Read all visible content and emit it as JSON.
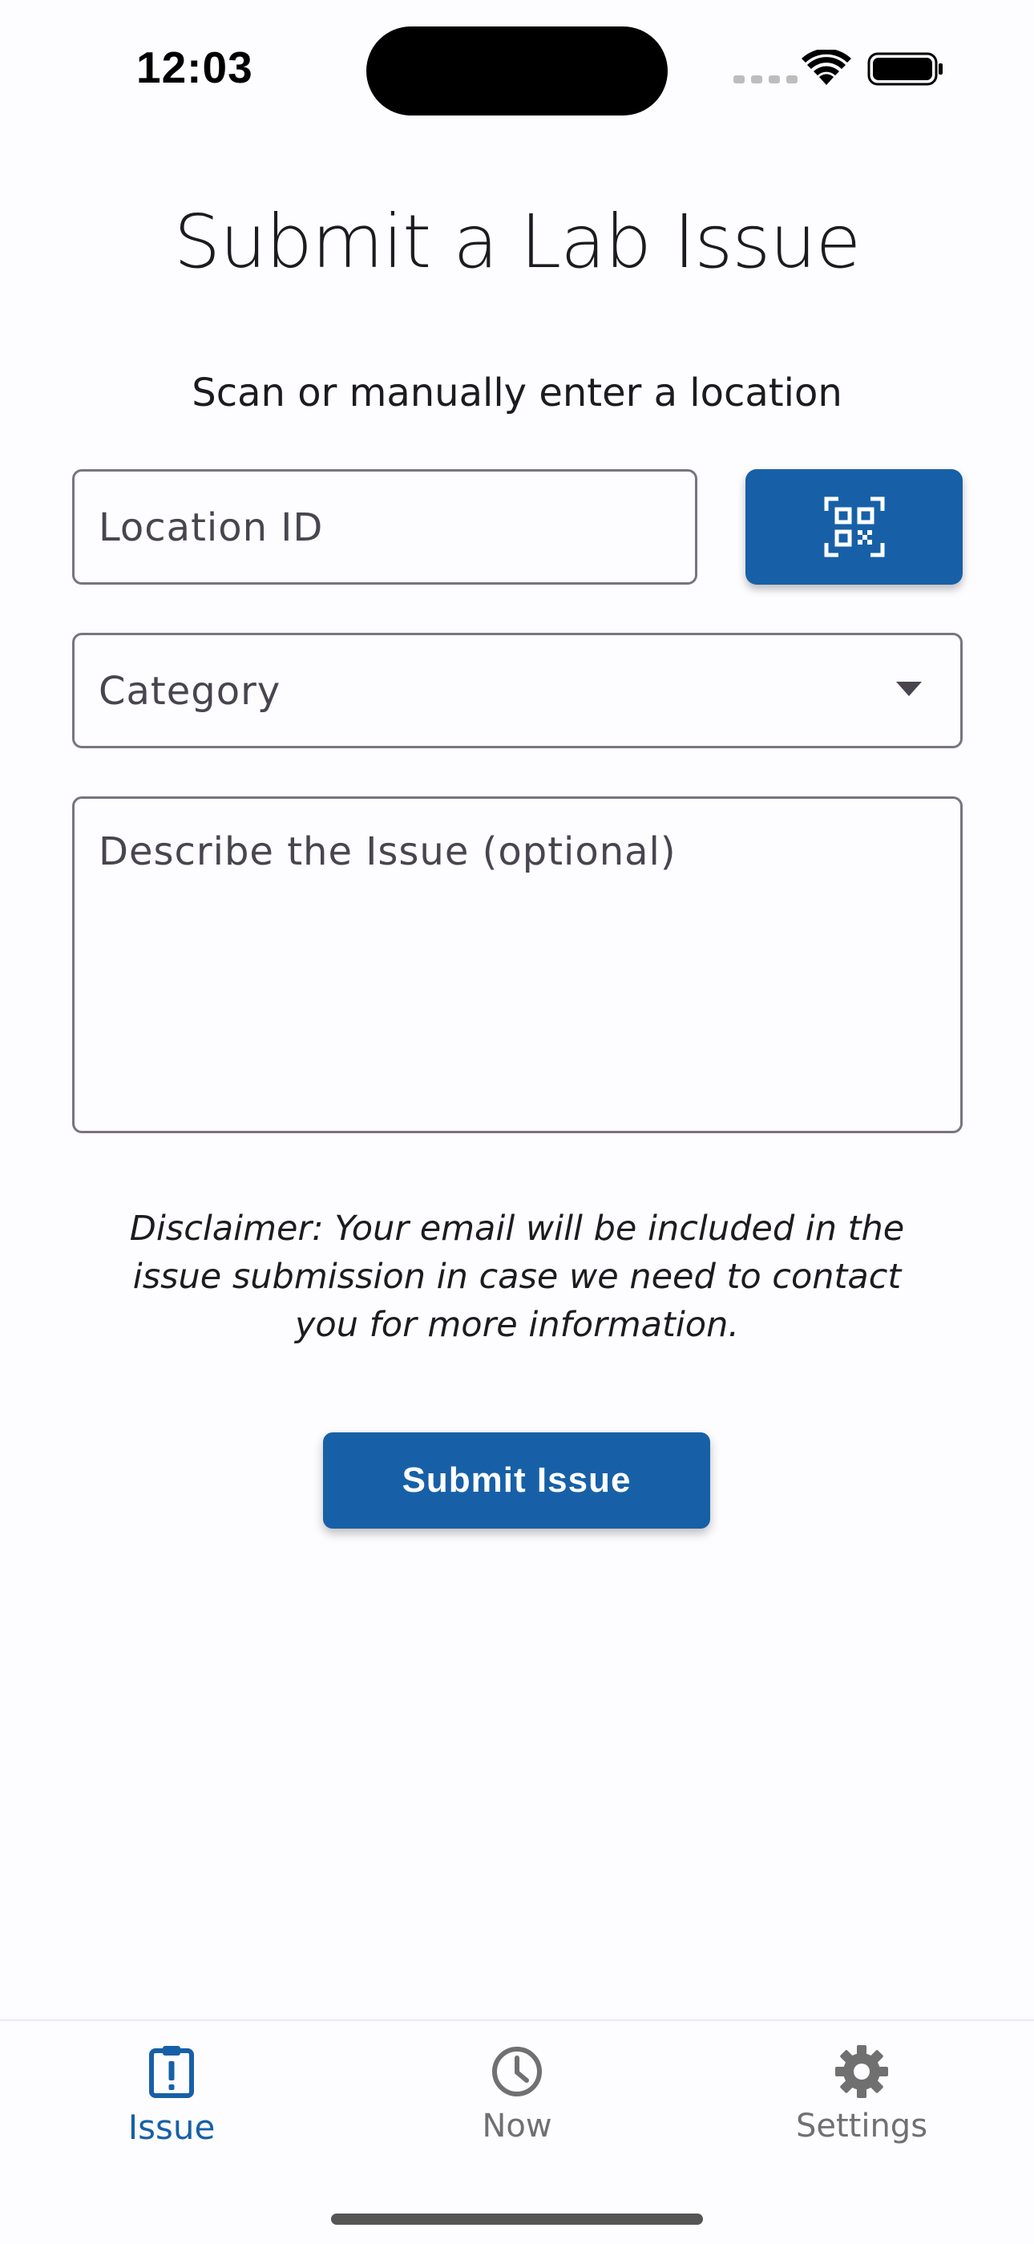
{
  "status_bar": {
    "time": "12:03"
  },
  "header": {
    "title": "Submit a Lab Issue",
    "subtitle": "Scan or manually enter a location"
  },
  "form": {
    "location_placeholder": "Location ID",
    "scan_icon": "qr-code-scanner-icon",
    "category_placeholder": "Category",
    "description_placeholder": "Describe the Issue (optional)",
    "disclaimer": "Disclaimer: Your email will be included in the issue submission in case we need to contact you for more information.",
    "submit_label": "Submit Issue"
  },
  "nav": {
    "items": [
      {
        "label": "Issue",
        "icon": "clipboard-alert-icon",
        "active": true
      },
      {
        "label": "Now",
        "icon": "clock-icon",
        "active": false
      },
      {
        "label": "Settings",
        "icon": "gear-icon",
        "active": false
      }
    ]
  },
  "colors": {
    "accent": "#1760a7",
    "inactive": "#707070",
    "border": "#79747e",
    "background": "#fdfcfe"
  }
}
